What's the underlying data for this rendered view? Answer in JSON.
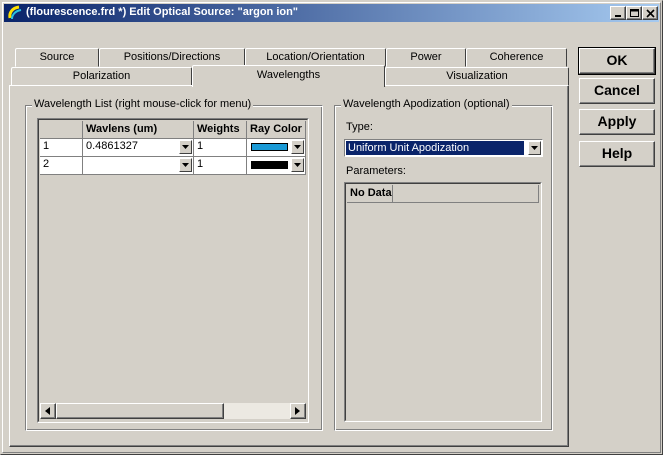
{
  "window": {
    "title": "(flourescence.frd *) Edit Optical Source: \"argon ion\""
  },
  "tabs_row1": [
    "Source",
    "Positions/Directions",
    "Location/Orientation",
    "Power",
    "Coherence"
  ],
  "tabs_row2": [
    "Polarization",
    "Wavelengths",
    "Visualization"
  ],
  "selected_tab": "Wavelengths",
  "buttons": {
    "ok": "OK",
    "cancel": "Cancel",
    "apply": "Apply",
    "help": "Help"
  },
  "wavelength_list": {
    "group_label": "Wavelength List (right mouse-click for menu)",
    "columns": [
      "Wavlens (um)",
      "Weights",
      "Ray Color"
    ],
    "rows": [
      {
        "num": "1",
        "wavelength": "0.4861327",
        "weight": "1",
        "ray_color": "#1a9ad6"
      },
      {
        "num": "2",
        "wavelength": "",
        "weight": "1",
        "ray_color": "#000000"
      }
    ]
  },
  "apodization": {
    "group_label": "Wavelength Apodization (optional)",
    "type_label": "Type:",
    "type_value": "Uniform Unit Apodization",
    "parameters_label": "Parameters:",
    "parameters_header": "No Data"
  },
  "colors": {
    "title_start": "#0a246a",
    "title_end": "#a6caf0",
    "face": "#d4d0c8",
    "selection": "#0a246a"
  },
  "icons": [
    "app-icon",
    "minimize-icon",
    "maximize-icon",
    "close-icon",
    "dropdown-arrow-icon",
    "scroll-left-icon",
    "scroll-right-icon"
  ]
}
